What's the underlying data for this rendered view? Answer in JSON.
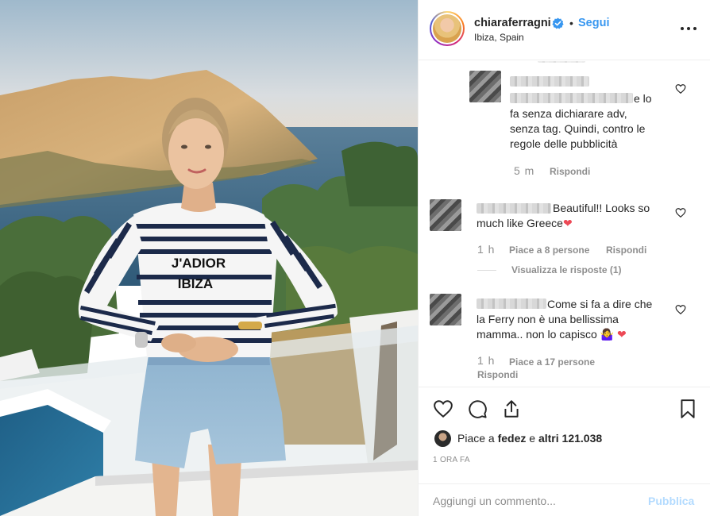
{
  "post": {
    "username": "chiaraferragni",
    "separator": "•",
    "follow_label": "Segui",
    "location": "Ibiza, Spain",
    "verified_icon": "verified-badge-icon",
    "more_icon": "more-options-icon"
  },
  "photo": {
    "shirt_text_line1": "J'ADIOR",
    "shirt_text_line2": "IBIZA"
  },
  "comments": [
    {
      "text": "e lo fa senza dichiarare adv, senza tag. Quindi, contro le regole delle pubblicità",
      "text_lines": [
        "e lo",
        "fa senza dichiarare adv,",
        "senza tag. Quindi, contro le",
        "regole delle pubblicità"
      ],
      "time": "5 m",
      "reply_label": "Rispondi"
    },
    {
      "text_lines": [
        "Beautiful!! Looks so",
        "much like Greece"
      ],
      "emoji": "❤",
      "time": "1 h",
      "likes_label": "Piace a 8 persone",
      "reply_label": "Rispondi",
      "view_replies": "Visualizza le risposte (1)"
    },
    {
      "text_lines": [
        "Come si fa a dire che",
        "la Ferry non è una bellissima",
        "mamma.. non lo capisco"
      ],
      "emoji": "🤷‍♀️ ❤",
      "time": "1 h",
      "likes_label": "Piace a 17 persone",
      "reply_label": "Rispondi"
    }
  ],
  "actions": {
    "like_icon": "heart-icon",
    "comment_icon": "comment-icon",
    "share_icon": "share-icon",
    "save_icon": "bookmark-icon"
  },
  "likes": {
    "prefix": "Piace a",
    "user": "fedez",
    "middle": "e",
    "others": "altri 121.038"
  },
  "timestamp": "1 ORA FA",
  "add_comment": {
    "placeholder": "Aggiungi un commento...",
    "publish_label": "Pubblica"
  },
  "colors": {
    "accent": "#3897f0",
    "publish_disabled": "#b3dbff",
    "heart_red": "#ed4956"
  }
}
